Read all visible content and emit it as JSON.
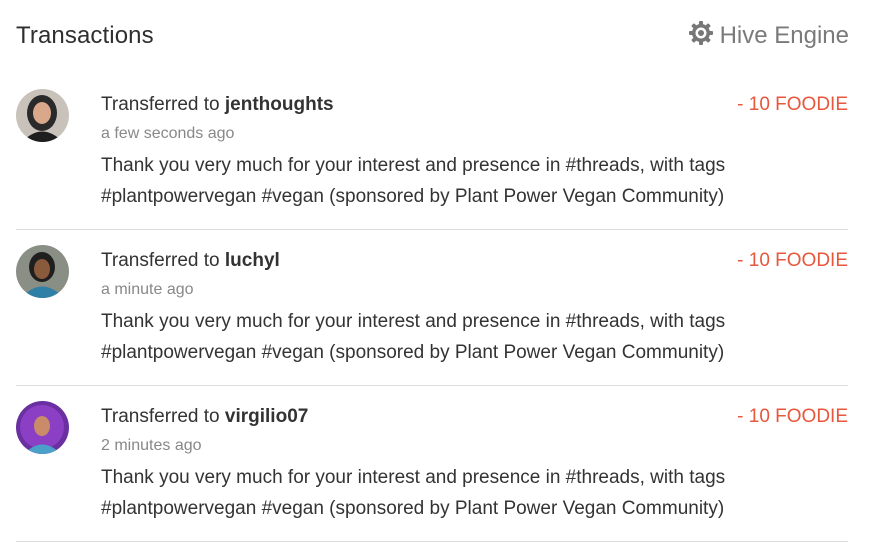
{
  "header": {
    "title": "Transactions",
    "engine_label": "Hive Engine",
    "engine_icon": "hive-engine-gear-icon"
  },
  "colors": {
    "amount": "#e8563c",
    "divider": "#dcdcdc"
  },
  "transactions": [
    {
      "prefix": "Transferred to ",
      "user": "jenthoughts",
      "time": "a few seconds ago",
      "memo_line1": "Thank you very much for your interest and presence in #threads, with tags",
      "memo_line2": "#plantpowervegan #vegan (sponsored by Plant Power Vegan Community)",
      "amount": "- 10 FOODIE"
    },
    {
      "prefix": "Transferred to ",
      "user": "luchyl",
      "time": "a minute ago",
      "memo_line1": "Thank you very much for your interest and presence in #threads, with tags",
      "memo_line2": "#plantpowervegan #vegan (sponsored by Plant Power Vegan Community)",
      "amount": "- 10 FOODIE"
    },
    {
      "prefix": "Transferred to ",
      "user": "virgilio07",
      "time": "2 minutes ago",
      "memo_line1": "Thank you very much for your interest and presence in #threads, with tags",
      "memo_line2": "#plantpowervegan #vegan (sponsored by Plant Power Vegan Community)",
      "amount": "- 10 FOODIE"
    }
  ]
}
